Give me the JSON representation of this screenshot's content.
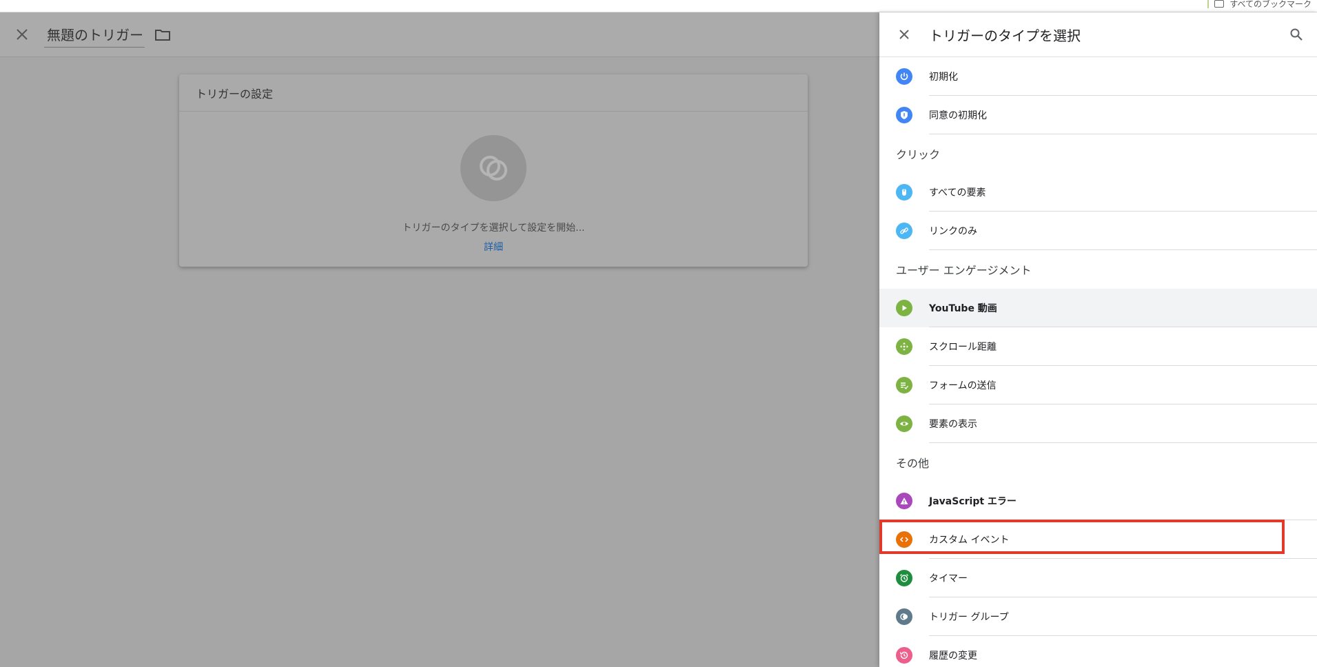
{
  "bookmarks": {
    "label": "すべてのブックマーク"
  },
  "editor": {
    "title": "無題のトリガー",
    "card": {
      "heading": "トリガーの設定",
      "hint": "トリガーのタイプを選択して設定を開始...",
      "link": "詳細"
    }
  },
  "panel": {
    "title": "トリガーのタイプを選択",
    "pageview": [
      {
        "label": "初期化",
        "color": "#4285f4",
        "icon": "power-icon"
      },
      {
        "label": "同意の初期化",
        "color": "#4285f4",
        "icon": "shield-icon"
      }
    ],
    "click_section": "クリック",
    "click": [
      {
        "label": "すべての要素",
        "color": "#4db6f5",
        "icon": "mouse-icon"
      },
      {
        "label": "リンクのみ",
        "color": "#4db6f5",
        "icon": "link-icon"
      }
    ],
    "engagement_section": "ユーザー エンゲージメント",
    "engagement": [
      {
        "label": "YouTube 動画",
        "color": "#7cb342",
        "icon": "play-icon"
      },
      {
        "label": "スクロール距離",
        "color": "#7cb342",
        "icon": "move-icon"
      },
      {
        "label": "フォームの送信",
        "color": "#7cb342",
        "icon": "form-icon"
      },
      {
        "label": "要素の表示",
        "color": "#7cb342",
        "icon": "eye-icon"
      }
    ],
    "other_section": "その他",
    "other": [
      {
        "label": "JavaScript エラー",
        "color": "#ab47bc",
        "icon": "warning-icon"
      },
      {
        "label": "カスタム イベント",
        "color": "#e8710a",
        "icon": "code-icon"
      },
      {
        "label": "タイマー",
        "color": "#1e8e3e",
        "icon": "alarm-icon"
      },
      {
        "label": "トリガー グループ",
        "color": "#5f7a8a",
        "icon": "group-icon"
      },
      {
        "label": "履歴の変更",
        "color": "#ec5e8c",
        "icon": "history-icon"
      }
    ]
  }
}
